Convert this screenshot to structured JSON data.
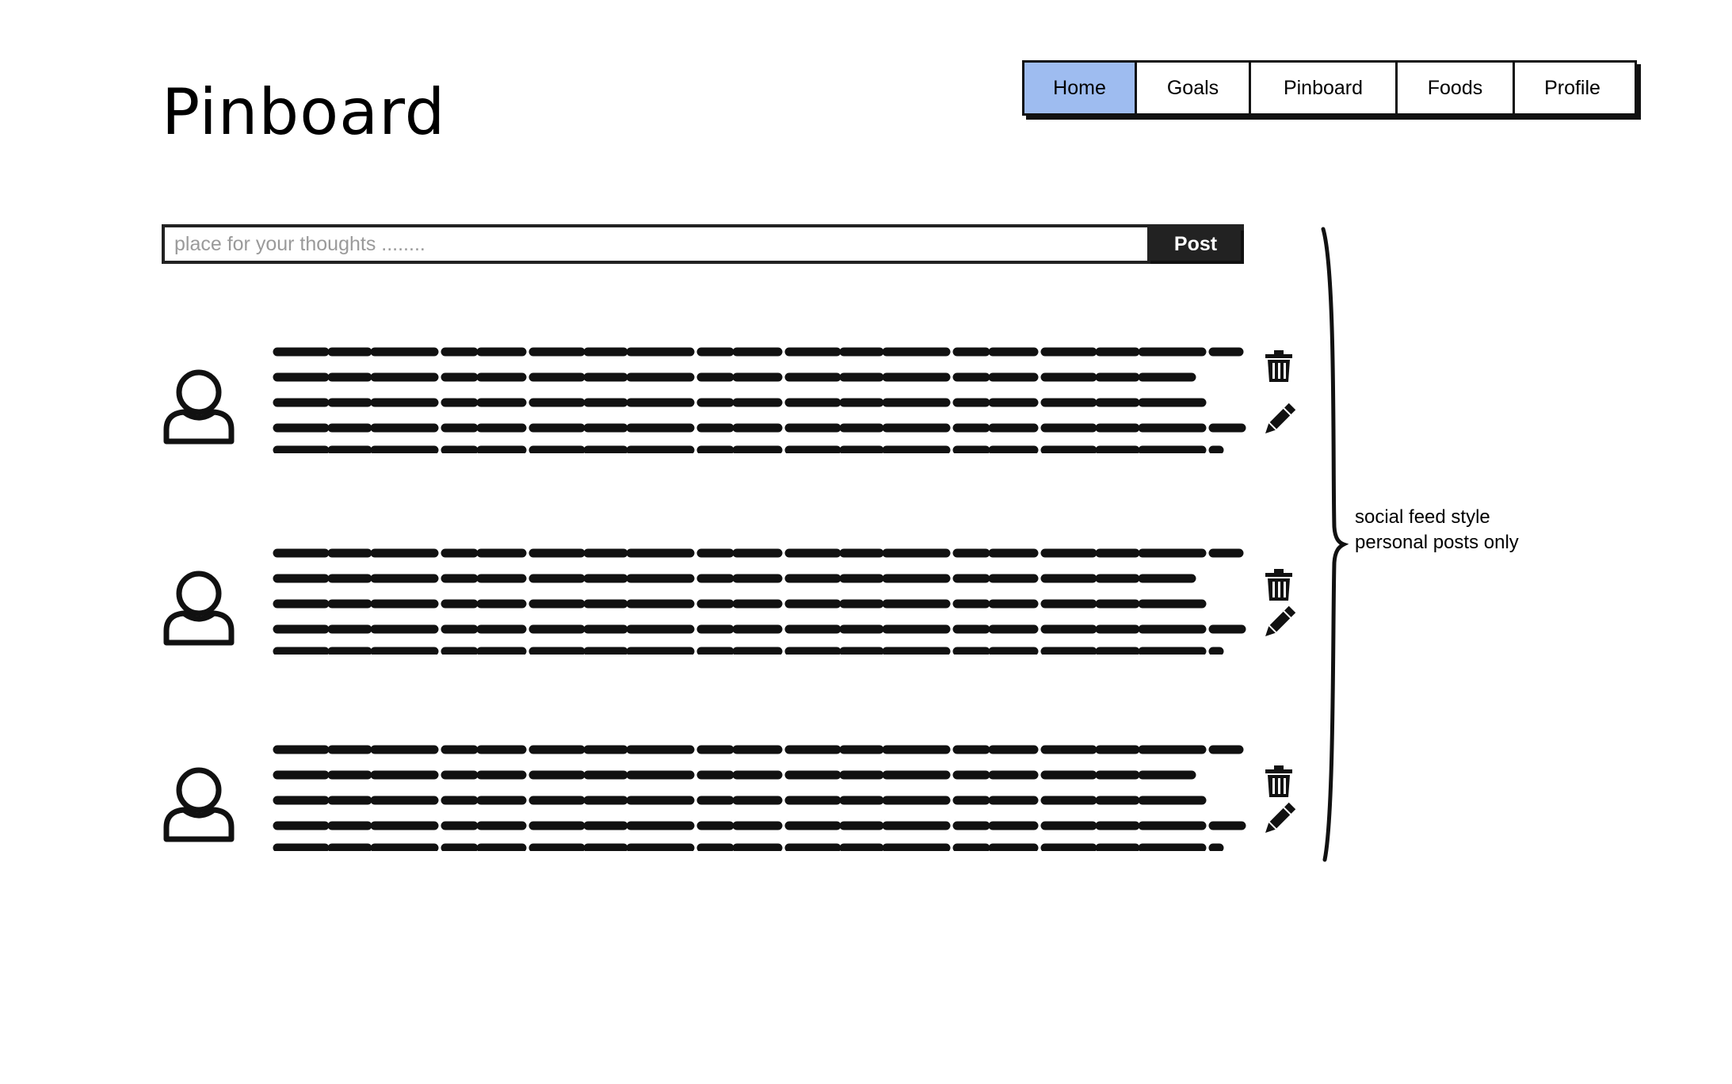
{
  "page": {
    "title": "Pinboard"
  },
  "nav": {
    "items": [
      {
        "label": "Home",
        "active": true
      },
      {
        "label": "Goals",
        "active": false
      },
      {
        "label": "Pinboard",
        "active": false
      },
      {
        "label": "Foods",
        "active": false
      },
      {
        "label": "Profile",
        "active": false
      }
    ]
  },
  "composer": {
    "placeholder": "place for your thoughts ........",
    "post_label": "Post"
  },
  "posts": [
    {
      "avatar_icon": "user-icon",
      "actions": [
        "trash-icon",
        "pencil-icon"
      ]
    },
    {
      "avatar_icon": "user-icon",
      "actions": [
        "trash-icon",
        "pencil-icon"
      ]
    },
    {
      "avatar_icon": "user-icon",
      "actions": [
        "trash-icon",
        "pencil-icon"
      ]
    }
  ],
  "annotation": {
    "line1": "social feed style",
    "line2": "personal posts only"
  },
  "colors": {
    "nav_active": "#9ebcf0",
    "ink": "#111111",
    "button_bg": "#222222",
    "placeholder": "#9a9a9a"
  }
}
